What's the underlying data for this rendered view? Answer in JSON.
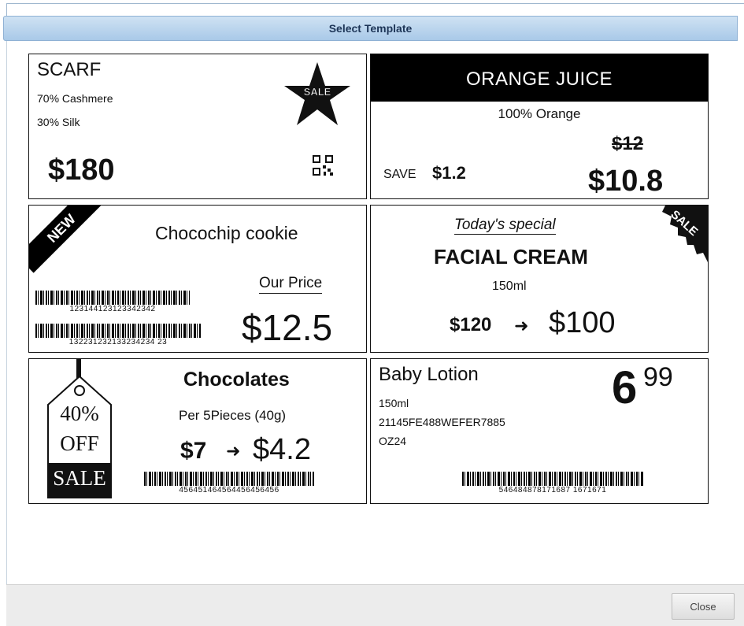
{
  "dialog": {
    "title": "Select Template",
    "close_label": "Close"
  },
  "templates": {
    "scarf": {
      "name": "SCARF",
      "line1": "70% Cashmere",
      "line2": "30% Silk",
      "price": "$180",
      "star_text": "SALE"
    },
    "orange": {
      "name": "ORANGE JUICE",
      "desc": "100% Orange",
      "old_price": "$12",
      "save_label": "SAVE",
      "save_amount": "$1.2",
      "price": "$10.8"
    },
    "cookie": {
      "ribbon": "NEW",
      "name": "Chocochip cookie",
      "our_price_label": "Our Price",
      "price": "$12.5",
      "barcode1": "123144123123342342",
      "barcode2": "132231232133234234 23"
    },
    "cream": {
      "special": "Today's special",
      "name": "FACIAL CREAM",
      "volume": "150ml",
      "old_price": "$120",
      "arrow": "➜",
      "price": "$100",
      "corner": "SALE"
    },
    "chocolates": {
      "tag_pct": "40%",
      "tag_off": "OFF",
      "tag_sale": "SALE",
      "name": "Chocolates",
      "desc": "Per 5Pieces (40g)",
      "old_price": "$7",
      "arrow": "➜",
      "price": "$4.2",
      "barcode": "456451464564456456456"
    },
    "lotion": {
      "name": "Baby Lotion",
      "price_main": "6",
      "price_cents": "99",
      "line1": "150ml",
      "line2": "21145FE488WEFER7885",
      "line3": "OZ24",
      "barcode": "546484878171687 1671671"
    }
  }
}
